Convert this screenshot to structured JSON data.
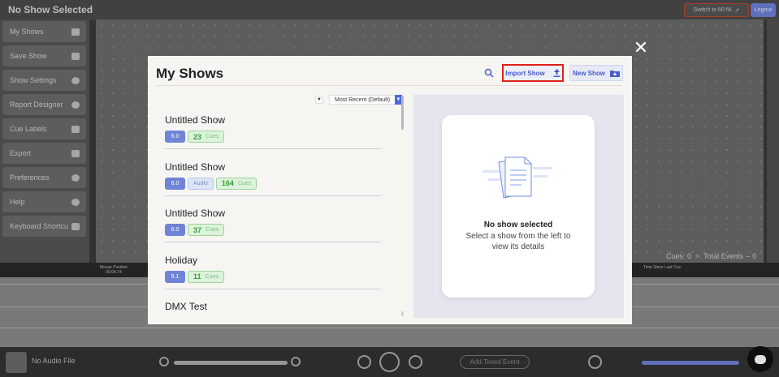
{
  "app": {
    "title": "No Show Selected",
    "switch_label": "Switch to 60 fA",
    "logout_label": "Logout"
  },
  "sidebar": {
    "items": [
      {
        "label": "My Shows"
      },
      {
        "label": "Save Show"
      },
      {
        "label": "Show Settings"
      },
      {
        "label": "Report Designer"
      },
      {
        "label": "Cue Labels"
      },
      {
        "label": "Export"
      },
      {
        "label": "Preferences"
      },
      {
        "label": "Help"
      },
      {
        "label": "Keyboard Shortcu"
      }
    ]
  },
  "status": {
    "cues": "Cues: 0",
    "total_events": "Total Events -- 0"
  },
  "timeline": {
    "mouse_position_label": "Mouse Position",
    "mouse_position_value": "00:04.74",
    "time_since_last_cue": "Time Since Last Cue"
  },
  "transport": {
    "audio_file": "No Audio File",
    "add_event_placeholder": "Add Timed Event"
  },
  "modal": {
    "title": "My Shows",
    "import_label": "Import Show",
    "new_label": "New Show",
    "sort_value": "Most Recent (Default)",
    "shows": [
      {
        "name": "Untitled Show",
        "version": "6.0",
        "audio": "",
        "cues": "23",
        "cues_label": "Cues"
      },
      {
        "name": "Untitled Show",
        "version": "6.0",
        "audio": "Audio",
        "cues": "164",
        "cues_label": "Cues"
      },
      {
        "name": "Untitled Show",
        "version": "6.0",
        "audio": "",
        "cues": "37",
        "cues_label": "Cues"
      },
      {
        "name": "Holiday",
        "version": "5.1",
        "audio": "",
        "cues": "11",
        "cues_label": "Cues"
      },
      {
        "name": "DMX Test",
        "version": "",
        "audio": "",
        "cues": "",
        "cues_label": ""
      }
    ],
    "empty_title": "No show selected",
    "empty_sub": "Select a show from the left to view its details"
  }
}
